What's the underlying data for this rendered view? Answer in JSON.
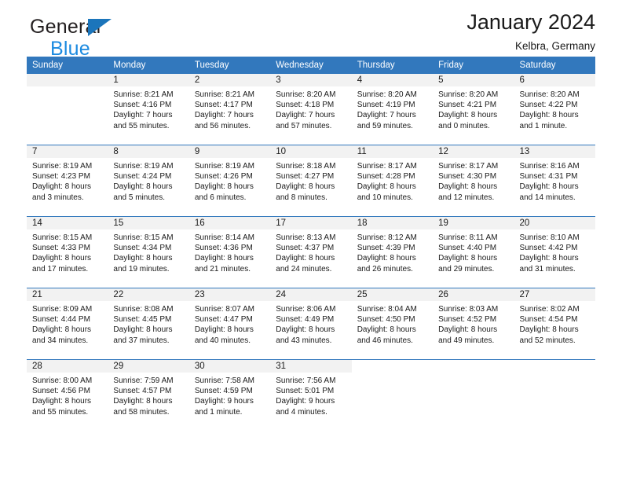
{
  "brand": {
    "name_part1": "General",
    "name_part2": "Blue",
    "triangle_icon": "triangle-icon",
    "colors": {
      "dark": "#231f20",
      "blue": "#1b8ae0",
      "triangle": "#1b75bb"
    }
  },
  "header": {
    "title": "January 2024",
    "subtitle": "Kelbra, Germany"
  },
  "theme": {
    "header_row_bg": "#3278bd",
    "header_row_text": "#ffffff",
    "daynum_band_bg": "#f2f2f2",
    "cell_bg": "#ffffff",
    "grid_line": "#3278bd",
    "body_text": "#1a1a1a"
  },
  "weekday_headers": [
    "Sunday",
    "Monday",
    "Tuesday",
    "Wednesday",
    "Thursday",
    "Friday",
    "Saturday"
  ],
  "weeks": [
    [
      {
        "day": "",
        "sunrise": "",
        "sunset": "",
        "daylight1": "",
        "daylight2": "",
        "empty": true
      },
      {
        "day": "1",
        "sunrise": "Sunrise: 8:21 AM",
        "sunset": "Sunset: 4:16 PM",
        "daylight1": "Daylight: 7 hours",
        "daylight2": "and 55 minutes."
      },
      {
        "day": "2",
        "sunrise": "Sunrise: 8:21 AM",
        "sunset": "Sunset: 4:17 PM",
        "daylight1": "Daylight: 7 hours",
        "daylight2": "and 56 minutes."
      },
      {
        "day": "3",
        "sunrise": "Sunrise: 8:20 AM",
        "sunset": "Sunset: 4:18 PM",
        "daylight1": "Daylight: 7 hours",
        "daylight2": "and 57 minutes."
      },
      {
        "day": "4",
        "sunrise": "Sunrise: 8:20 AM",
        "sunset": "Sunset: 4:19 PM",
        "daylight1": "Daylight: 7 hours",
        "daylight2": "and 59 minutes."
      },
      {
        "day": "5",
        "sunrise": "Sunrise: 8:20 AM",
        "sunset": "Sunset: 4:21 PM",
        "daylight1": "Daylight: 8 hours",
        "daylight2": "and 0 minutes."
      },
      {
        "day": "6",
        "sunrise": "Sunrise: 8:20 AM",
        "sunset": "Sunset: 4:22 PM",
        "daylight1": "Daylight: 8 hours",
        "daylight2": "and 1 minute."
      }
    ],
    [
      {
        "day": "7",
        "sunrise": "Sunrise: 8:19 AM",
        "sunset": "Sunset: 4:23 PM",
        "daylight1": "Daylight: 8 hours",
        "daylight2": "and 3 minutes."
      },
      {
        "day": "8",
        "sunrise": "Sunrise: 8:19 AM",
        "sunset": "Sunset: 4:24 PM",
        "daylight1": "Daylight: 8 hours",
        "daylight2": "and 5 minutes."
      },
      {
        "day": "9",
        "sunrise": "Sunrise: 8:19 AM",
        "sunset": "Sunset: 4:26 PM",
        "daylight1": "Daylight: 8 hours",
        "daylight2": "and 6 minutes."
      },
      {
        "day": "10",
        "sunrise": "Sunrise: 8:18 AM",
        "sunset": "Sunset: 4:27 PM",
        "daylight1": "Daylight: 8 hours",
        "daylight2": "and 8 minutes."
      },
      {
        "day": "11",
        "sunrise": "Sunrise: 8:17 AM",
        "sunset": "Sunset: 4:28 PM",
        "daylight1": "Daylight: 8 hours",
        "daylight2": "and 10 minutes."
      },
      {
        "day": "12",
        "sunrise": "Sunrise: 8:17 AM",
        "sunset": "Sunset: 4:30 PM",
        "daylight1": "Daylight: 8 hours",
        "daylight2": "and 12 minutes."
      },
      {
        "day": "13",
        "sunrise": "Sunrise: 8:16 AM",
        "sunset": "Sunset: 4:31 PM",
        "daylight1": "Daylight: 8 hours",
        "daylight2": "and 14 minutes."
      }
    ],
    [
      {
        "day": "14",
        "sunrise": "Sunrise: 8:15 AM",
        "sunset": "Sunset: 4:33 PM",
        "daylight1": "Daylight: 8 hours",
        "daylight2": "and 17 minutes."
      },
      {
        "day": "15",
        "sunrise": "Sunrise: 8:15 AM",
        "sunset": "Sunset: 4:34 PM",
        "daylight1": "Daylight: 8 hours",
        "daylight2": "and 19 minutes."
      },
      {
        "day": "16",
        "sunrise": "Sunrise: 8:14 AM",
        "sunset": "Sunset: 4:36 PM",
        "daylight1": "Daylight: 8 hours",
        "daylight2": "and 21 minutes."
      },
      {
        "day": "17",
        "sunrise": "Sunrise: 8:13 AM",
        "sunset": "Sunset: 4:37 PM",
        "daylight1": "Daylight: 8 hours",
        "daylight2": "and 24 minutes."
      },
      {
        "day": "18",
        "sunrise": "Sunrise: 8:12 AM",
        "sunset": "Sunset: 4:39 PM",
        "daylight1": "Daylight: 8 hours",
        "daylight2": "and 26 minutes."
      },
      {
        "day": "19",
        "sunrise": "Sunrise: 8:11 AM",
        "sunset": "Sunset: 4:40 PM",
        "daylight1": "Daylight: 8 hours",
        "daylight2": "and 29 minutes."
      },
      {
        "day": "20",
        "sunrise": "Sunrise: 8:10 AM",
        "sunset": "Sunset: 4:42 PM",
        "daylight1": "Daylight: 8 hours",
        "daylight2": "and 31 minutes."
      }
    ],
    [
      {
        "day": "21",
        "sunrise": "Sunrise: 8:09 AM",
        "sunset": "Sunset: 4:44 PM",
        "daylight1": "Daylight: 8 hours",
        "daylight2": "and 34 minutes."
      },
      {
        "day": "22",
        "sunrise": "Sunrise: 8:08 AM",
        "sunset": "Sunset: 4:45 PM",
        "daylight1": "Daylight: 8 hours",
        "daylight2": "and 37 minutes."
      },
      {
        "day": "23",
        "sunrise": "Sunrise: 8:07 AM",
        "sunset": "Sunset: 4:47 PM",
        "daylight1": "Daylight: 8 hours",
        "daylight2": "and 40 minutes."
      },
      {
        "day": "24",
        "sunrise": "Sunrise: 8:06 AM",
        "sunset": "Sunset: 4:49 PM",
        "daylight1": "Daylight: 8 hours",
        "daylight2": "and 43 minutes."
      },
      {
        "day": "25",
        "sunrise": "Sunrise: 8:04 AM",
        "sunset": "Sunset: 4:50 PM",
        "daylight1": "Daylight: 8 hours",
        "daylight2": "and 46 minutes."
      },
      {
        "day": "26",
        "sunrise": "Sunrise: 8:03 AM",
        "sunset": "Sunset: 4:52 PM",
        "daylight1": "Daylight: 8 hours",
        "daylight2": "and 49 minutes."
      },
      {
        "day": "27",
        "sunrise": "Sunrise: 8:02 AM",
        "sunset": "Sunset: 4:54 PM",
        "daylight1": "Daylight: 8 hours",
        "daylight2": "and 52 minutes."
      }
    ],
    [
      {
        "day": "28",
        "sunrise": "Sunrise: 8:00 AM",
        "sunset": "Sunset: 4:56 PM",
        "daylight1": "Daylight: 8 hours",
        "daylight2": "and 55 minutes."
      },
      {
        "day": "29",
        "sunrise": "Sunrise: 7:59 AM",
        "sunset": "Sunset: 4:57 PM",
        "daylight1": "Daylight: 8 hours",
        "daylight2": "and 58 minutes."
      },
      {
        "day": "30",
        "sunrise": "Sunrise: 7:58 AM",
        "sunset": "Sunset: 4:59 PM",
        "daylight1": "Daylight: 9 hours",
        "daylight2": "and 1 minute."
      },
      {
        "day": "31",
        "sunrise": "Sunrise: 7:56 AM",
        "sunset": "Sunset: 5:01 PM",
        "daylight1": "Daylight: 9 hours",
        "daylight2": "and 4 minutes."
      },
      {
        "day": "",
        "sunrise": "",
        "sunset": "",
        "daylight1": "",
        "daylight2": "",
        "blank": true
      },
      {
        "day": "",
        "sunrise": "",
        "sunset": "",
        "daylight1": "",
        "daylight2": "",
        "blank": true
      },
      {
        "day": "",
        "sunrise": "",
        "sunset": "",
        "daylight1": "",
        "daylight2": "",
        "blank": true
      }
    ]
  ]
}
